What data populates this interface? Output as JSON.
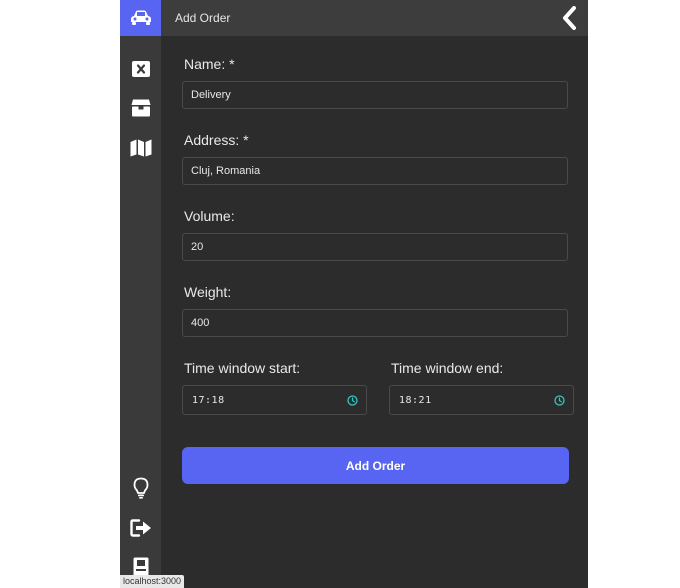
{
  "header": {
    "title": "Add Order"
  },
  "sidebar": {
    "items": [
      {
        "icon": "car-icon"
      },
      {
        "icon": "close-square-icon"
      },
      {
        "icon": "box-icon"
      },
      {
        "icon": "map-icon"
      }
    ],
    "bottom_items": [
      {
        "icon": "lightbulb-icon"
      },
      {
        "icon": "sign-out-icon"
      },
      {
        "icon": "id-badge-icon"
      }
    ]
  },
  "form": {
    "name": {
      "label": "Name: *",
      "value": "Delivery"
    },
    "address": {
      "label": "Address: *",
      "value": "Cluj, Romania"
    },
    "volume": {
      "label": "Volume:",
      "value": "20"
    },
    "weight": {
      "label": "Weight:",
      "value": "400"
    },
    "time_start": {
      "label": "Time window start:",
      "value": "17:18"
    },
    "time_end": {
      "label": "Time window end:",
      "value": "18:21"
    },
    "submit_label": "Add Order"
  },
  "status": {
    "url": "localhost:3000"
  },
  "colors": {
    "accent": "#5865f2",
    "panel": "#2c2c2c",
    "sidebar": "#3a3a3a",
    "clock": "#35c6c2"
  }
}
